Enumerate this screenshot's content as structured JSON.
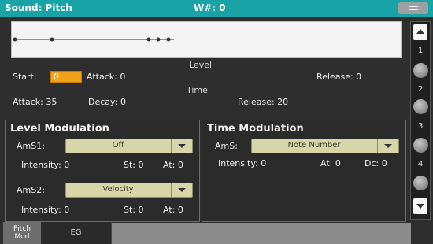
{
  "topbar": {
    "title": "Sound: Pitch",
    "wave": "W#: 0"
  },
  "envelope": {
    "level_label": "Level",
    "time_label": "Time",
    "start_label": "Start:",
    "start_value": "0",
    "level_attack": "Attack: 0",
    "level_release": "Release: 0",
    "time_attack": "Attack: 35",
    "time_decay": "Decay: 0",
    "time_release": "Release: 20"
  },
  "level_mod": {
    "header": "Level Modulation",
    "amS1_label": "AmS1:",
    "amS1_value": "Off",
    "intensity1": "Intensity: 0",
    "st1": "St: 0",
    "at1": "At: 0",
    "amS2_label": "AmS2:",
    "amS2_value": "Velocity",
    "intensity2": "Intensity: 0",
    "st2": "St: 0",
    "at2": "At: 0"
  },
  "time_mod": {
    "header": "Time Modulation",
    "amS_label": "AmS:",
    "amS_value": "Note Number",
    "intensity": "Intensity: 0",
    "at": "At: 0",
    "dc": "Dc: 0"
  },
  "scroll": {
    "marks": [
      "1",
      "2",
      "3",
      "4"
    ]
  },
  "tabs": {
    "active": [
      "Pitch",
      "Mod"
    ],
    "inactive": "EG"
  },
  "colors": {
    "topbar": "#1aa3a7",
    "start_highlight": "#f0a21a",
    "dropdown": "#d6d6a8"
  }
}
